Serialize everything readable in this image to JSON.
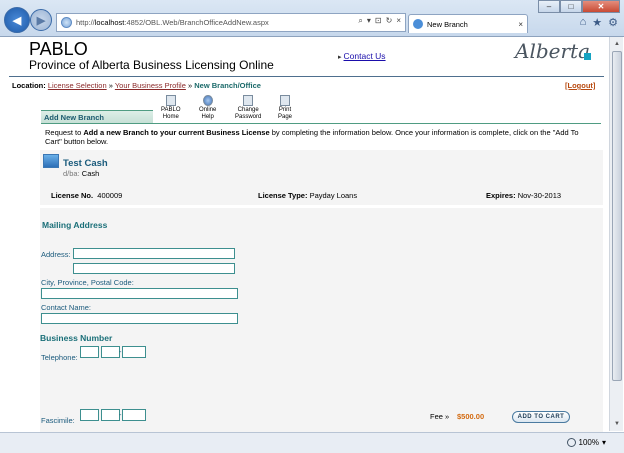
{
  "browser": {
    "url_prefix": "http://",
    "url_host": "localhost",
    "url_rest": ":4852/OBL.Web/BranchOfficeAddNew.aspx",
    "tab_title": "New Branch",
    "tab_close": "×",
    "addr_tools": [
      "⌕",
      "▾",
      "⊡",
      "↻",
      "×"
    ],
    "window_controls": {
      "min": "–",
      "max": "□",
      "close": "✕"
    },
    "toolbar_icons": [
      "⌂",
      "★",
      "⚙"
    ],
    "zoom": "100%",
    "zoom_caret": "▾"
  },
  "header": {
    "app_name": "PABLO",
    "subtitle": "Province of Alberta Business Licensing Online",
    "contact_link": "Contact Us",
    "logo_text": "Alberta"
  },
  "location": {
    "label": "Location:",
    "crumbs": [
      "License Selection",
      "Your Business Profile"
    ],
    "separator": "»",
    "current": "New Branch/Office",
    "logout": "[Logout]"
  },
  "section": {
    "title": "Add New Branch"
  },
  "tools": [
    {
      "label1": "PABLO",
      "label2": "Home"
    },
    {
      "label1": "Online",
      "label2": "Help"
    },
    {
      "label1": "Change",
      "label2": "Password"
    },
    {
      "label1": "Print",
      "label2": "Page"
    }
  ],
  "intro": {
    "p1": "Request to ",
    "bold": "Add a new Branch to your current Business License",
    "p2": " by completing the information below. Once your information is complete, click on the \"Add To Cart\" button below."
  },
  "business": {
    "name": "Test Cash",
    "dba_label": "d/ba:",
    "dba_value": "Cash",
    "license_no_label": "License No.",
    "license_no": "400009",
    "license_type_label": "License Type:",
    "license_type": "Payday Loans",
    "expires_label": "Expires:",
    "expires": "Nov-30-2013"
  },
  "form": {
    "mailing_heading": "Mailing Address",
    "address_label": "Address:",
    "city_label": "City, Province, Postal Code:",
    "contact_label": "Contact Name:",
    "business_number_heading": "Business Number",
    "telephone_label": "Telephone:",
    "fax_label": "Fascimile:",
    "phone_separator": "-",
    "fee_label": "Fee »",
    "fee_amount": "$500.00",
    "add_to_cart": "ADD TO CART"
  },
  "colors": {
    "accent_teal": "#1a6f78",
    "fee_orange": "#d36a10",
    "link_maroon": "#8a2a2a"
  }
}
